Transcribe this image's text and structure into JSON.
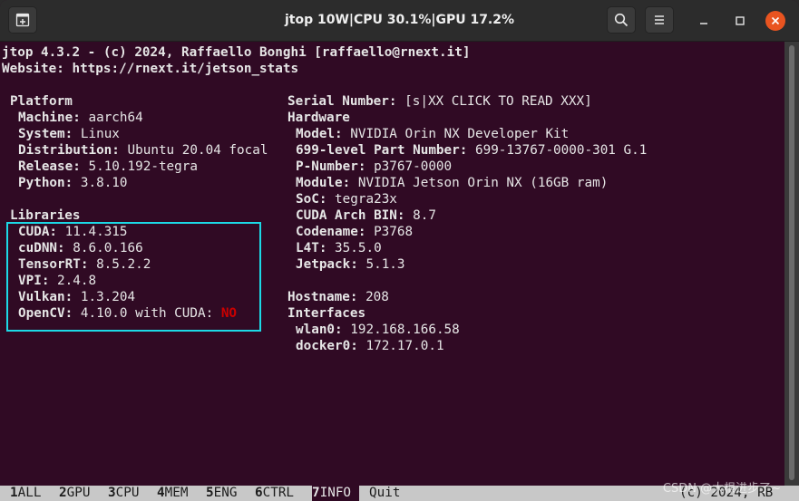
{
  "window": {
    "title": "jtop 10W|CPU 30.1%|GPU 17.2%"
  },
  "header": {
    "line1": "jtop 4.3.2 - (c) 2024, Raffaello Bonghi [raffaello@rnext.it]",
    "line2": "Website: https://rnext.it/jetson_stats"
  },
  "platform": {
    "title": "Platform",
    "items": [
      {
        "label": "Machine:",
        "value": " aarch64"
      },
      {
        "label": "System:",
        "value": " Linux"
      },
      {
        "label": "Distribution:",
        "value": " Ubuntu 20.04 focal"
      },
      {
        "label": "Release:",
        "value": " 5.10.192-tegra"
      },
      {
        "label": "Python:",
        "value": " 3.8.10"
      }
    ]
  },
  "libraries": {
    "title": "Libraries",
    "items": [
      {
        "label": "CUDA:",
        "value": " 11.4.315"
      },
      {
        "label": "cuDNN:",
        "value": " 8.6.0.166"
      },
      {
        "label": "TensorRT:",
        "value": " 8.5.2.2"
      },
      {
        "label": "VPI:",
        "value": " 2.4.8"
      },
      {
        "label": "Vulkan:",
        "value": " 1.3.204"
      },
      {
        "label": "OpenCV:",
        "value": " 4.10.0 with CUDA: ",
        "extra": "NO"
      }
    ]
  },
  "serial": {
    "label": "Serial Number:",
    "value": " [s|XX CLICK TO READ XXX]"
  },
  "hardware": {
    "title": "Hardware",
    "items": [
      {
        "label": "Model:",
        "value": " NVIDIA Orin NX Developer Kit"
      },
      {
        "label": "699-level Part Number:",
        "value": " 699-13767-0000-301 G.1"
      },
      {
        "label": "P-Number:",
        "value": " p3767-0000"
      },
      {
        "label": "Module:",
        "value": " NVIDIA Jetson Orin NX (16GB ram)"
      },
      {
        "label": "SoC:",
        "value": " tegra23x"
      },
      {
        "label": "CUDA Arch BIN:",
        "value": " 8.7"
      },
      {
        "label": "Codename:",
        "value": " P3768"
      },
      {
        "label": "L4T:",
        "value": " 35.5.0"
      },
      {
        "label": "Jetpack:",
        "value": " 5.1.3"
      }
    ]
  },
  "hostname": {
    "label": "Hostname:",
    "value": " 208"
  },
  "interfaces": {
    "title": "Interfaces",
    "items": [
      {
        "label": "wlan0:",
        "value": " 192.168.166.58"
      },
      {
        "label": "docker0:",
        "value": " 172.17.0.1"
      }
    ]
  },
  "bottombar": {
    "tabs": [
      {
        "num": "1",
        "label": "ALL"
      },
      {
        "num": "2",
        "label": "GPU"
      },
      {
        "num": "3",
        "label": "CPU"
      },
      {
        "num": "4",
        "label": "MEM"
      },
      {
        "num": "5",
        "label": "ENG"
      },
      {
        "num": "6",
        "label": "CTRL"
      },
      {
        "num": "7",
        "label": "INFO"
      }
    ],
    "selected_index": 6,
    "quit": "Quit",
    "right": "(c) 2024, RB"
  },
  "watermark": "CSDN @大根进步了~",
  "colors": {
    "terminal_bg": "#300a24",
    "highlight_box": "#1cd9e6",
    "no_text": "#cc0000",
    "close_button": "#e95420"
  },
  "icons": {
    "new_tab": "new-tab-icon",
    "search": "search-icon",
    "menu": "hamburger-menu-icon",
    "minimize": "minimize-icon",
    "maximize": "maximize-icon",
    "close": "close-icon"
  }
}
